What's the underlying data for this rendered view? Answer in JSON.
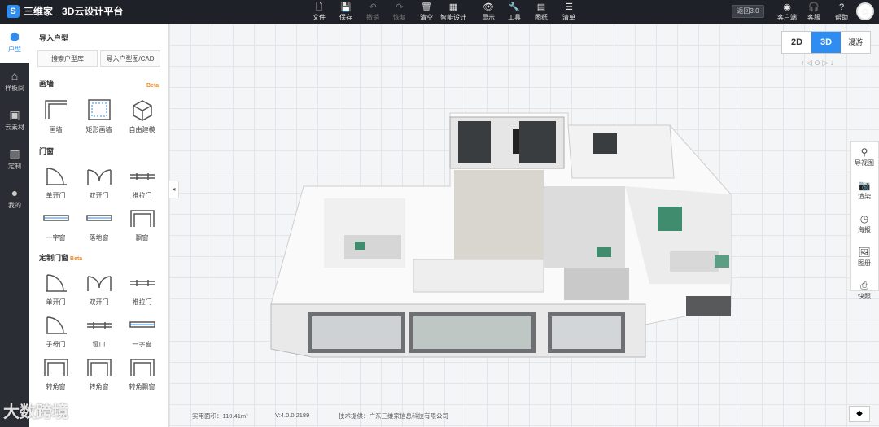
{
  "app": {
    "logo_glyph": "S",
    "brand": "三维家",
    "title": "3D云设计平台"
  },
  "toolbar": [
    {
      "label": "文件",
      "icon": "file-icon",
      "glyph": "🗋",
      "enabled": true
    },
    {
      "label": "保存",
      "icon": "save-icon",
      "glyph": "💾",
      "enabled": true
    },
    {
      "label": "撤销",
      "icon": "undo-icon",
      "glyph": "↶",
      "enabled": false
    },
    {
      "label": "恢复",
      "icon": "redo-icon",
      "glyph": "↷",
      "enabled": false
    },
    {
      "label": "清空",
      "icon": "clear-icon",
      "glyph": "🗑",
      "enabled": true
    },
    {
      "label": "智能设计",
      "icon": "smart-design-icon",
      "glyph": "▦",
      "enabled": true
    },
    {
      "label": "显示",
      "icon": "eye-icon",
      "glyph": "👁",
      "enabled": true
    },
    {
      "label": "工具",
      "icon": "wrench-icon",
      "glyph": "🔧",
      "enabled": true
    },
    {
      "label": "图纸",
      "icon": "drawing-icon",
      "glyph": "▤",
      "enabled": true
    },
    {
      "label": "清单",
      "icon": "list-icon",
      "glyph": "☰",
      "enabled": true
    }
  ],
  "header_right": {
    "back_label": "返回3.0",
    "client_label": "客户端",
    "client_glyph": "◉",
    "service_label": "客服",
    "service_glyph": "🎧",
    "help_label": "帮助",
    "help_glyph": "?",
    "avatar_glyph": "☺"
  },
  "leftnav": [
    {
      "label": "户型",
      "glyph": "⬢",
      "active": true
    },
    {
      "label": "样板间",
      "glyph": "⌂",
      "active": false
    },
    {
      "label": "云素材",
      "glyph": "▣",
      "active": false
    },
    {
      "label": "定制",
      "glyph": "▥",
      "active": false
    },
    {
      "label": "我的",
      "glyph": "●",
      "active": false
    }
  ],
  "panel": {
    "import_title": "导入户型",
    "btn_search": "搜索户型库",
    "btn_import": "导入户型图/CAD",
    "wall_title": "画墙",
    "beta": "Beta",
    "walls": [
      "画墙",
      "矩形画墙",
      "自由建模"
    ],
    "door_title": "门窗",
    "doors": [
      "单开门",
      "双开门",
      "推拉门",
      "一字窗",
      "落地窗",
      "飘窗"
    ],
    "custom_title": "定制门窗",
    "custom": [
      "单开门",
      "双开门",
      "推拉门",
      "子母门",
      "垭口",
      "一字窗",
      "转角窗",
      "转角窗",
      "转角飘窗"
    ]
  },
  "view": {
    "tabs": [
      "2D",
      "3D",
      "漫游"
    ],
    "active": "3D",
    "compass": "↑ ◁ ⊙ ▷ ↓"
  },
  "right_tools": [
    {
      "label": "导视图",
      "glyph": "⚲"
    },
    {
      "label": "渲染",
      "glyph": "📷"
    },
    {
      "label": "海报",
      "glyph": "◷"
    },
    {
      "label": "图册",
      "glyph": "🖼"
    },
    {
      "label": "快照",
      "glyph": "⎙"
    }
  ],
  "status": {
    "area": "实用面积：110.41m²",
    "version": "V:4.0.0.2189",
    "support": "技术提供：广东三维家信息科技有限公司"
  },
  "watermark": "大数跨境",
  "colors": {
    "accent": "#2f8cf0",
    "topbar": "#1e2127",
    "beta": "#f08a24"
  }
}
